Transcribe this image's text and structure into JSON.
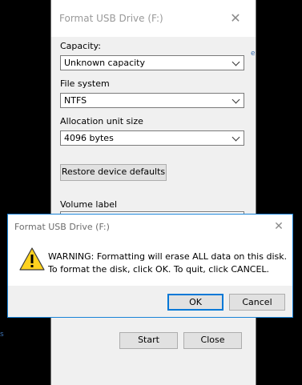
{
  "format_window": {
    "title": "Format USB Drive (F:)",
    "close_glyph": "✕",
    "capacity_label": "Capacity:",
    "capacity_value": "Unknown capacity",
    "file_system_label": "File system",
    "file_system_value": "NTFS",
    "allocation_label": "Allocation unit size",
    "allocation_value": "4096 bytes",
    "restore_button": "Restore device defaults",
    "volume_label": "Volume label",
    "start_button": "Start",
    "close_button": "Close"
  },
  "dialog": {
    "title": "Format USB Drive (F:)",
    "close_glyph": "✕",
    "icon": "warning-icon",
    "message_line1": "WARNING: Formatting will erase ALL data on this disk.",
    "message_line2": "To format the disk, click OK. To quit, click CANCEL.",
    "ok_button": "OK",
    "cancel_button": "Cancel"
  },
  "colors": {
    "accent": "#0078d7",
    "dialog_border": "#1883d7",
    "warning_yellow": "#ffd21f"
  }
}
